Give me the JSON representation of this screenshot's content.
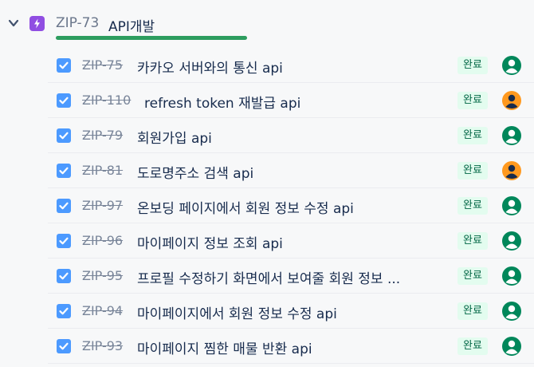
{
  "epic": {
    "key": "ZIP-73",
    "title": "API개발",
    "progress": 1.0
  },
  "status_label": "완료",
  "colors": {
    "epic": "#904ee2",
    "checkbox": "#4c9aff",
    "done_badge_bg": "#e3fcef",
    "done_badge_text": "#006644",
    "avatar_green": "#00875a",
    "avatar_orange": "#ff991f",
    "progress": "#2d9d5f"
  },
  "issues": [
    {
      "key": "ZIP-75",
      "title": "카카오 서버와의 통신 api",
      "status": "완료",
      "avatar": "green"
    },
    {
      "key": "ZIP-110",
      "title": "refresh token 재발급 api",
      "status": "완료",
      "avatar": "orange"
    },
    {
      "key": "ZIP-79",
      "title": "회원가입 api",
      "status": "완료",
      "avatar": "green"
    },
    {
      "key": "ZIP-81",
      "title": "도로명주소 검색 api",
      "status": "완료",
      "avatar": "orange"
    },
    {
      "key": "ZIP-97",
      "title": "온보딩 페이지에서 회원 정보 수정 api",
      "status": "완료",
      "avatar": "green"
    },
    {
      "key": "ZIP-96",
      "title": "마이페이지 정보 조회 api",
      "status": "완료",
      "avatar": "green"
    },
    {
      "key": "ZIP-95",
      "title": "프로필 수정하기 화면에서 보여줄 회원 정보 ...",
      "status": "완료",
      "avatar": "green"
    },
    {
      "key": "ZIP-94",
      "title": "마이페이지에서 회원 정보 수정 api",
      "status": "완료",
      "avatar": "green"
    },
    {
      "key": "ZIP-93",
      "title": "마이페이지 찜한 매물 반환 api",
      "status": "완료",
      "avatar": "green"
    }
  ]
}
